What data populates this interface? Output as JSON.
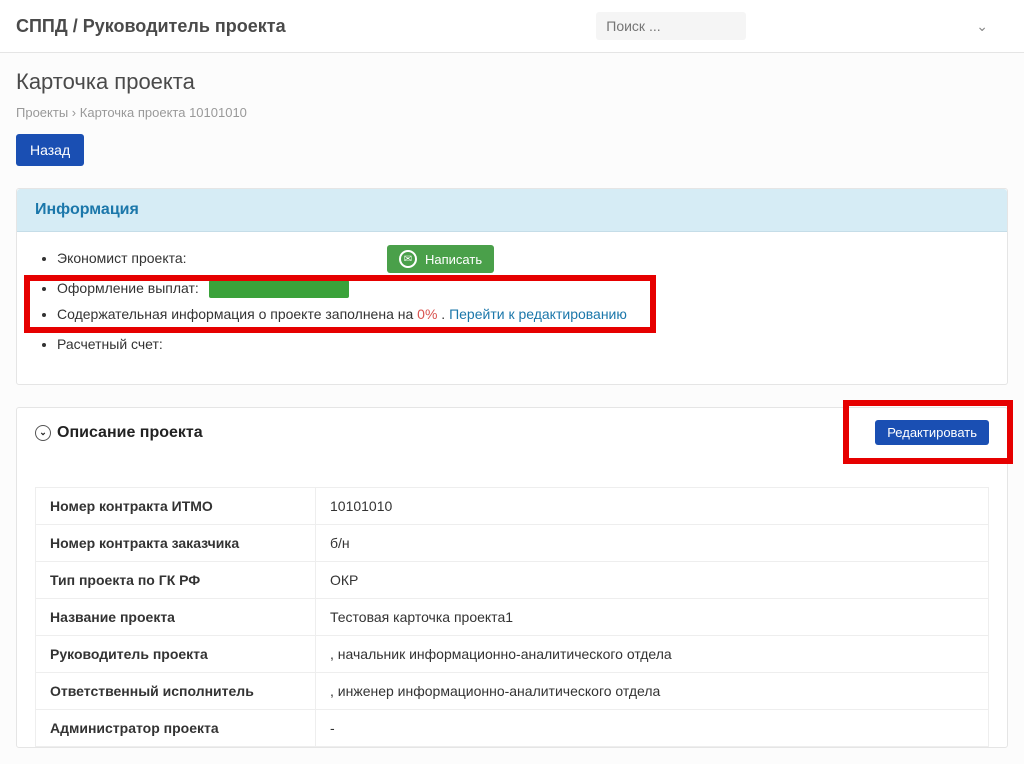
{
  "topbar": {
    "title": "СППД / Руководитель проекта",
    "search_placeholder": "Поиск ..."
  },
  "page": {
    "heading": "Карточка проекта",
    "breadcrumb_root": "Проекты",
    "breadcrumb_sep": "›",
    "breadcrumb_current": "Карточка проекта 10101010",
    "back_label": "Назад"
  },
  "info_panel": {
    "title": "Информация",
    "items": {
      "economist_label": "Экономист проекта:",
      "payments_label": "Оформление выплат:",
      "content_prefix": "Содержательная информация о проекте заполнена на ",
      "content_percent": "0%",
      "content_dot": " . ",
      "content_link": "Перейти к редактированию",
      "account_label": "Расчетный счет:"
    },
    "write_label": "Написать"
  },
  "description": {
    "section_title": "Описание проекта",
    "edit_label": "Редактировать",
    "rows": [
      {
        "k": "Номер контракта ИТМО",
        "v": "10101010"
      },
      {
        "k": "Номер контракта заказчика",
        "v": "б/н"
      },
      {
        "k": "Тип проекта по ГК РФ",
        "v": "ОКР"
      },
      {
        "k": "Название проекта",
        "v": "Тестовая карточка проекта1"
      },
      {
        "k": "Руководитель проекта",
        "v": ", начальник информационно-аналитического отдела"
      },
      {
        "k": "Ответственный исполнитель",
        "v": ", инженер информационно-аналитического отдела"
      },
      {
        "k": "Администратор проекта",
        "v": "-"
      }
    ]
  }
}
